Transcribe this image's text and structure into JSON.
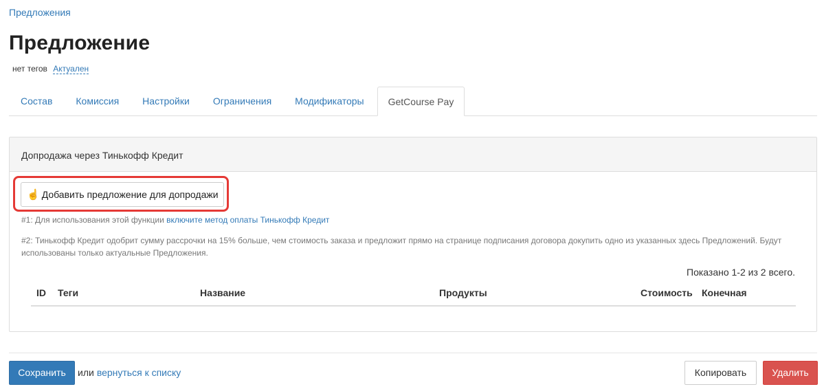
{
  "breadcrumb": {
    "label": "Предложения"
  },
  "page": {
    "title": "Предложение",
    "tags_text": "нет тегов",
    "status": "Актуален"
  },
  "tabs": [
    {
      "label": "Состав"
    },
    {
      "label": "Комиссия"
    },
    {
      "label": "Настройки"
    },
    {
      "label": "Ограничения"
    },
    {
      "label": "Модификаторы"
    },
    {
      "label": "GetCourse Pay",
      "active": true
    }
  ],
  "panel": {
    "heading": "Допродажа через Тинькофф Кредит",
    "add_button": "Добавить предложение для допродажи",
    "note1_prefix": "#1: Для использования этой функции ",
    "note1_link": "включите метод оплаты Тинькофф Кредит",
    "note2": "#2: Тинькофф Кредит одобрит сумму рассрочки на 15% больше, чем стоимость заказа и предложит прямо на странице подписания договора докупить одно из указанных здесь Предложений. Будут использованы только актуальные Предложения.",
    "summary": "Показано 1-2 из 2 всего.",
    "columns": [
      "ID",
      "Теги",
      "Название",
      "Продукты",
      "Стоимость",
      "Конечная"
    ]
  },
  "footer": {
    "save": "Сохранить",
    "or": "или",
    "back": "вернуться к списку",
    "copy": "Копировать",
    "delete": "Удалить"
  },
  "colors": {
    "primary": "#337ab7",
    "danger": "#d9534f",
    "highlight": "#e53935"
  },
  "icons": {
    "add_button_icon": "hand-pointer-icon"
  }
}
